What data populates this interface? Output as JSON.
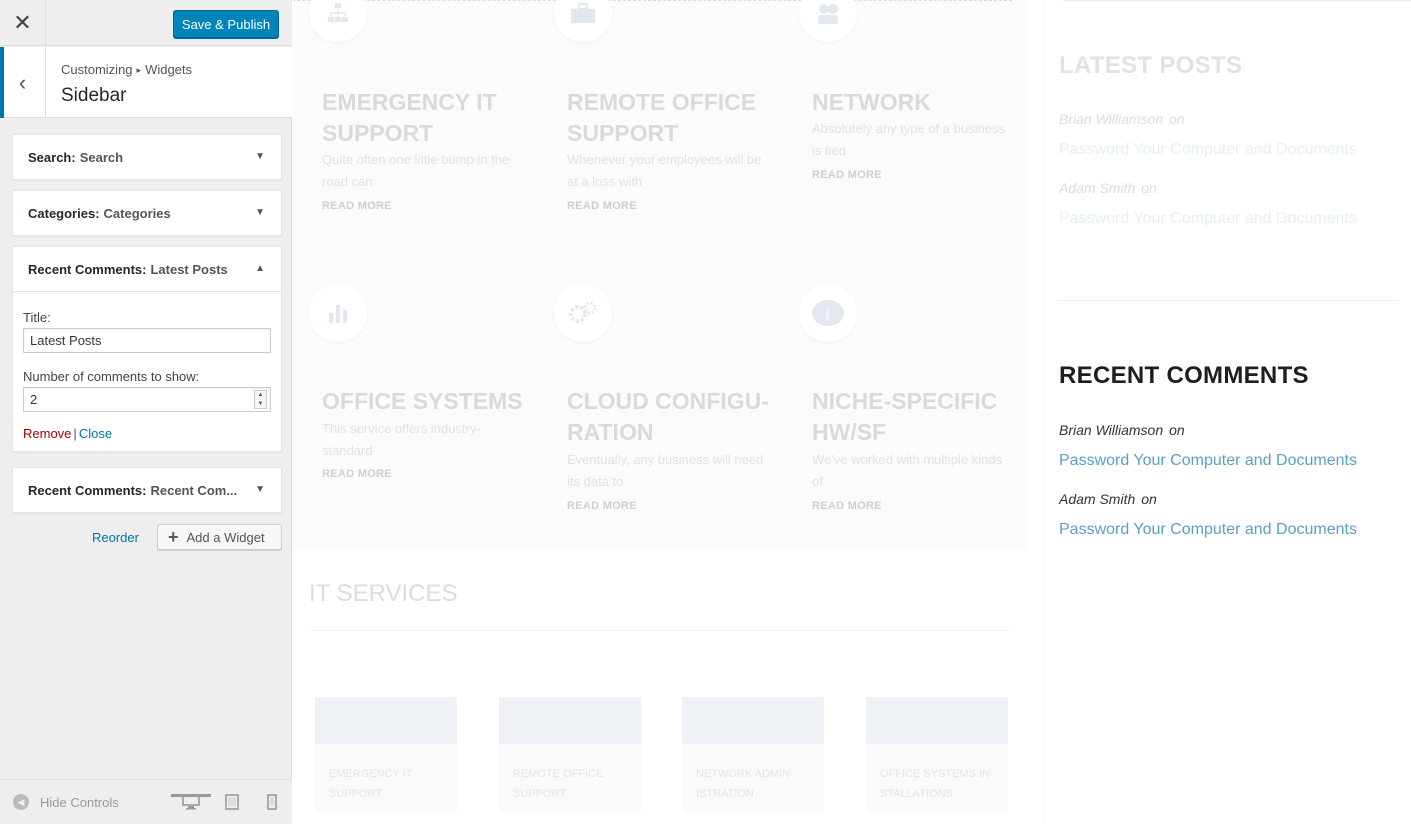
{
  "topbar": {
    "close_glyph": "✕",
    "publish_label": "Save & Publish"
  },
  "section": {
    "breadcrumb_root": "Customizing",
    "breadcrumb_sep": "▸",
    "breadcrumb_leaf": "Widgets",
    "title": "Sidebar",
    "back_glyph": "‹"
  },
  "widgets": [
    {
      "type": "Search:",
      "name": "Search",
      "arrow": "▼"
    },
    {
      "type": "Categories:",
      "name": "Categories",
      "arrow": "▼"
    },
    {
      "type": "Recent Comments:",
      "name": "Latest Posts",
      "arrow": "▲",
      "title_label": "Title:",
      "title_value": "Latest Posts",
      "count_label": "Number of comments to show:",
      "count_value": "2",
      "remove_label": "Remove",
      "close_label": "Close",
      "separator": "|"
    },
    {
      "type": "Recent Comments:",
      "name": "Recent Com...",
      "arrow": "▼"
    }
  ],
  "controls": {
    "reorder_label": "Reorder",
    "add_widget_label": "Add a Widget",
    "add_glyph": "+"
  },
  "footer": {
    "hide_controls_label": "Hide Controls",
    "hide_glyph": "◀",
    "devices": [
      "desktop-icon",
      "tablet-icon",
      "mobile-icon"
    ]
  },
  "preview": {
    "services": [
      {
        "title": "EMERGENCY IT SUPPORT",
        "desc": "Quite often one little bump in the road can",
        "read_more": "READ MORE",
        "icon": "sitemap-icon"
      },
      {
        "title": "REMOTE OFFICE SUPPORT",
        "desc": "Whenever your employees will be at a loss with",
        "read_more": "READ MORE",
        "icon": "briefcase-icon"
      },
      {
        "title": "NETWORK",
        "desc": "Absolutely any type of a business is tied",
        "read_more": "READ MORE",
        "icon": "users-icon"
      },
      {
        "title": "OFFICE SYSTEMS",
        "desc": "This service offers industry-standard",
        "read_more": "READ MORE",
        "icon": "bar-chart-icon"
      },
      {
        "title": "CLOUD CONFIGU-RATION",
        "desc": "Eventually, any business will need its data to",
        "read_more": "READ MORE",
        "icon": "gears-icon"
      },
      {
        "title": "NICHE-SPECIFIC HW/SF",
        "desc": "We've worked with multiple kinds of",
        "read_more": "READ MORE",
        "icon": "info-icon"
      }
    ],
    "it_services_heading": "IT SERVICES",
    "cards": [
      "EMERGENCY IT SUPPORT",
      "REMOTE OFFICE SUPPORT",
      "NETWORK ADMIN-ISTRATION",
      "OFFICE SYSTEMS IN-STALLATIONS"
    ],
    "latest_posts": {
      "title": "LATEST POSTS",
      "items": [
        {
          "author": "Brian Williamson",
          "on": "on",
          "link": "Password Your Computer and Documents"
        },
        {
          "author": "Adam Smith",
          "on": "on",
          "link": "Password Your Computer and Documents"
        }
      ]
    },
    "recent_comments": {
      "title": "RECENT COMMENTS",
      "items": [
        {
          "author": "Brian Williamson",
          "on": "on",
          "link": "Password Your Computer and Documents"
        },
        {
          "author": "Adam Smith",
          "on": "on",
          "link": "Password Your Computer and Documents"
        }
      ]
    },
    "colors": {
      "accent": "#0085ba",
      "link": "#5a9fc5",
      "faint_link": "#e6eff5"
    }
  }
}
